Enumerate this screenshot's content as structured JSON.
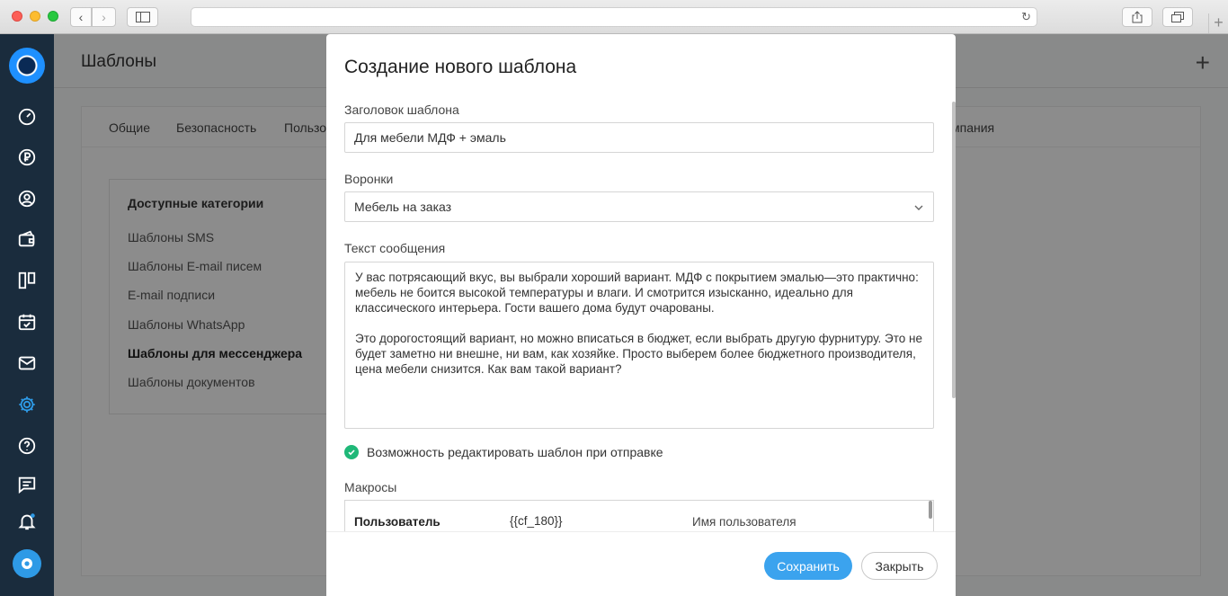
{
  "browser": {
    "back_glyph": "‹",
    "forward_glyph": "›",
    "reload_glyph": "↻",
    "newtab_glyph": "+"
  },
  "app": {
    "page_title": "Шаблоны",
    "add_glyph": "+",
    "tabs": [
      "Общие",
      "Безопасность",
      "Пользо",
      "мпания"
    ],
    "categories_title": "Доступные категории",
    "categories": [
      "Шаблоны SMS",
      "Шаблоны E-mail писем",
      "E-mail подписи",
      "Шаблоны WhatsApp",
      "Шаблоны для мессенджера",
      "Шаблоны документов"
    ],
    "active_category": "Шаблоны для мессенджера",
    "nav_icons": [
      "dashboard-icon",
      "ruble-icon",
      "contact-icon",
      "wallet-icon",
      "kanban-icon",
      "calendar-icon",
      "mail-icon",
      "gear-icon",
      "help-icon",
      "chat-icon",
      "bell-icon",
      "messenger-icon"
    ]
  },
  "modal": {
    "title": "Создание нового шаблона",
    "title_label": "Заголовок шаблона",
    "title_value": "Для мебели МДФ + эмаль",
    "funnels_label": "Воронки",
    "funnels_value": "Мебель на заказ",
    "message_label": "Текст сообщения",
    "message_value": "У вас потрясающий вкус, вы выбрали хороший вариант. МДФ с покрытием эмалью—это практично: мебель не боится высокой температуры и влаги. И смотрится изысканно, идеально для классического интерьера. Гости вашего дома будут очарованы.\n\nЭто дорогостоящий вариант, но можно вписаться в бюджет, если выбрать другую фурнитуру. Это не будет заметно ни внешне, ни вам, как хозяйке. Просто выберем более бюджетного производителя, цена мебели снизится. Как вам такой вариант?",
    "editable_label": "Возможность редактировать шаблон при отправке",
    "editable_checked": true,
    "macros_label": "Макросы",
    "macros": [
      {
        "name": "Пользователь",
        "code": "{{cf_180}}",
        "description": "Имя пользователя"
      }
    ],
    "save_label": "Сохранить",
    "close_label": "Закрыть"
  },
  "colors": {
    "accent": "#3ba3ee",
    "check": "#1fb878",
    "nav_bg": "#1a2c3d",
    "nav_active": "#2e9ae6"
  }
}
